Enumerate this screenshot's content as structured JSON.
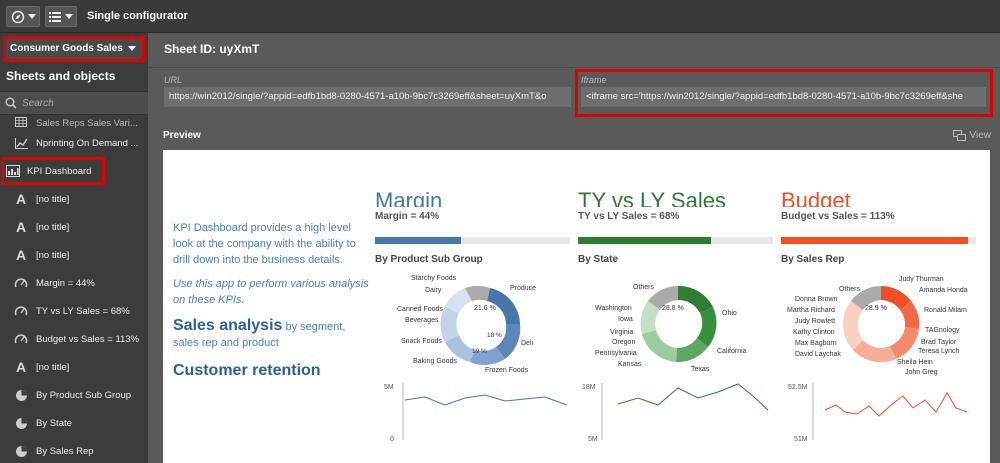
{
  "topbar": {
    "title": "Single configurator"
  },
  "sidebar": {
    "app_name": "Consumer Goods Sales",
    "header": "Sheets and objects",
    "search_placeholder": "Search",
    "items": [
      {
        "label": "Sales Reps Sales Vari...",
        "icon": "table-icon"
      },
      {
        "label": "Nprinting On Demand ...",
        "icon": "line-chart-icon"
      },
      {
        "label": "KPI Dashboard",
        "icon": "sheet-icon"
      },
      {
        "label": "[no title]",
        "icon": "text-icon"
      },
      {
        "label": "[no title]",
        "icon": "text-icon"
      },
      {
        "label": "[no title]",
        "icon": "text-icon"
      },
      {
        "label": "Margin = 44%",
        "icon": "gauge-icon"
      },
      {
        "label": "TY vs LY Sales = 68%",
        "icon": "gauge-icon"
      },
      {
        "label": "Budget vs Sales = 113%",
        "icon": "gauge-icon"
      },
      {
        "label": "[no title]",
        "icon": "text-icon"
      },
      {
        "label": "By Product Sub Group",
        "icon": "pie-icon"
      },
      {
        "label": "By State",
        "icon": "pie-icon"
      },
      {
        "label": "By Sales Rep",
        "icon": "pie-icon"
      }
    ]
  },
  "main": {
    "sheet_id": "Sheet ID: uyXmT",
    "url_label": "URL",
    "url_value": "https://win2012/single/?appid=edfb1bd8-0280-4571-a10b-9bc7c3269eff&sheet=uyXmT&o",
    "iframe_label": "Iframe",
    "iframe_value": "<iframe src='https://win2012/single/?appid=edfb1bd8-0280-4571-a10b-9bc7c3269eff&she",
    "preview_label": "Preview",
    "view_label": "View"
  },
  "preview": {
    "intro_1": "KPI Dashboard provides a high level look at the company with the ability to drill down into the business details.",
    "intro_2": "Use this app to perform various analysis on these KPIs.",
    "sales_analysis_bold": "Sales analysis",
    "sales_analysis_rest": " by segment, sales rep and product",
    "customer_retention": "Customer retention",
    "panels": [
      {
        "title": "Margin",
        "kpi": "Margin = 44%",
        "progress": 0.44,
        "color": "#4477aa",
        "sub": "By Product Sub Group",
        "center": "21.6 %",
        "labels": [
          "Starchy Foods",
          "Dairy",
          "Canned Foods",
          "Beverages",
          "Snack Foods",
          "Baking Goods",
          "Produce",
          "Deli",
          "Frozen Foods",
          "18 %",
          "19 %"
        ],
        "axis_top": "5M",
        "axis_bottom": "0"
      },
      {
        "title": "TY vs LY Sales",
        "kpi": "TY vs LY Sales = 68%",
        "progress": 0.68,
        "color": "#2e7d32",
        "sub": "By State",
        "center": "28.8 %",
        "labels": [
          "Others",
          "Washington",
          "Iowa",
          "Virginia",
          "Oregon",
          "Pennsylvania",
          "Kansas",
          "Ohio",
          "California",
          "Texas"
        ],
        "axis_top": "18M",
        "axis_bottom": "5M"
      },
      {
        "title": "Budget",
        "kpi": "Budget vs Sales = 113%",
        "progress": 0.96,
        "color": "#f04e23",
        "sub": "By Sales Rep",
        "center": "28.9 %",
        "labels": [
          "Others",
          "Judy Thurman",
          "Amanda Honda",
          "Donna Brown",
          "Martha Richard",
          "Judy Rowlett",
          "Kathy Clinton",
          "Max Bagburn",
          "David Laychak",
          "Ronald Milam",
          "TAGnology",
          "Brad Taylor",
          "Teresa Lynch",
          "Sheila Hein",
          "John Greg"
        ],
        "axis_top": "52.5M",
        "axis_bottom": "51M"
      }
    ]
  },
  "colors": {
    "highlight": "#e10000",
    "margin": "#4477aa",
    "ty": "#2e7d32",
    "budget": "#f04e23"
  }
}
